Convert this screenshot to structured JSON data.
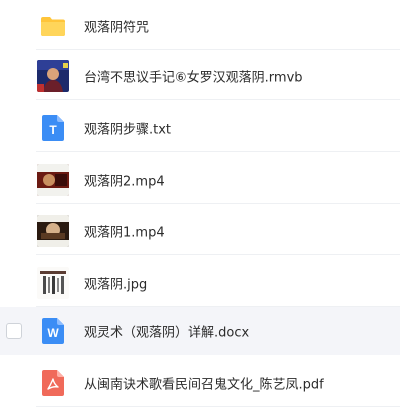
{
  "files": [
    {
      "name": "观落阴符咒",
      "icon": "folder-icon"
    },
    {
      "name": "台湾不思议手记⑥女罗汉观落阴.rmvb",
      "icon": "video-thumbnail"
    },
    {
      "name": "观落阴步骤.txt",
      "icon": "text-file-icon",
      "icon_letter": "T"
    },
    {
      "name": "观落阴2.mp4",
      "icon": "video-thumbnail"
    },
    {
      "name": "观落阴1.mp4",
      "icon": "video-thumbnail"
    },
    {
      "name": "观落阴.jpg",
      "icon": "image-thumbnail"
    },
    {
      "name": "观灵术（观落阴）详解.docx",
      "icon": "word-file-icon",
      "icon_letter": "W",
      "selected_row": true
    },
    {
      "name": "从闽南诀术歌看民间召鬼文化_陈艺凤.pdf",
      "icon": "pdf-file-icon"
    }
  ],
  "colors": {
    "folder": "#ffcf4a",
    "txt_icon": "#3b8df5",
    "docx_icon": "#3b8df5",
    "pdf_icon": "#f06a5a",
    "highlight_row": "#f4f5f9"
  }
}
